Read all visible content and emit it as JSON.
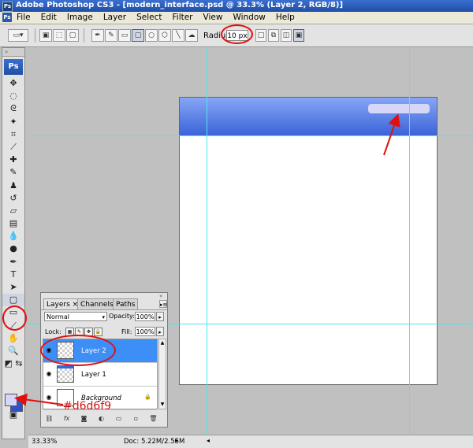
{
  "window": {
    "title": "Adobe Photoshop CS3 - [modern_interface.psd @ 33.3% (Layer 2, RGB/8)]",
    "app_badge": "Ps"
  },
  "menu": {
    "items": [
      "File",
      "Edit",
      "Image",
      "Layer",
      "Select",
      "Filter",
      "View",
      "Window",
      "Help"
    ]
  },
  "options": {
    "radius_label": "Radius:",
    "radius_value": "10 px"
  },
  "toolbox": {
    "logo": "Ps",
    "grip": "»",
    "tools": [
      "move-tool-icon",
      "marquee-tool-icon",
      "lasso-tool-icon",
      "magic-wand-tool-icon",
      "crop-tool-icon",
      "eyedropper-tool-icon",
      "healing-brush-tool-icon",
      "brush-tool-icon",
      "clone-stamp-tool-icon",
      "history-brush-tool-icon",
      "eraser-tool-icon",
      "gradient-tool-icon",
      "blur-tool-icon",
      "dodge-tool-icon",
      "pen-tool-icon",
      "type-tool-icon",
      "path-selection-tool-icon",
      "rounded-rectangle-tool-icon",
      "notes-tool-icon",
      "eyedropper-2-tool-icon",
      "hand-tool-icon",
      "zoom-tool-icon"
    ],
    "fg_color": "#d6d6f9",
    "bg_color": "#3050c8"
  },
  "annotations": {
    "color_hex": "#d6d6f9",
    "circle_color": "#e01010"
  },
  "document": {
    "header_color": "#3b63d8",
    "pill_color": "#d6d6f9"
  },
  "layers_panel": {
    "tabs": [
      "Layers",
      "Channels",
      "Paths"
    ],
    "tab_close": "×",
    "blend_mode": "Normal",
    "opacity_label": "Opacity:",
    "opacity_value": "100%",
    "lock_label": "Lock:",
    "fill_label": "Fill:",
    "fill_value": "100%",
    "layers": [
      {
        "name": "Layer 2",
        "selected": true
      },
      {
        "name": "Layer 1",
        "selected": false
      },
      {
        "name": "Background",
        "selected": false,
        "locked": true
      }
    ]
  },
  "status": {
    "zoom": "33.33%",
    "doc_size": "Doc: 5.22M/2.55M"
  }
}
